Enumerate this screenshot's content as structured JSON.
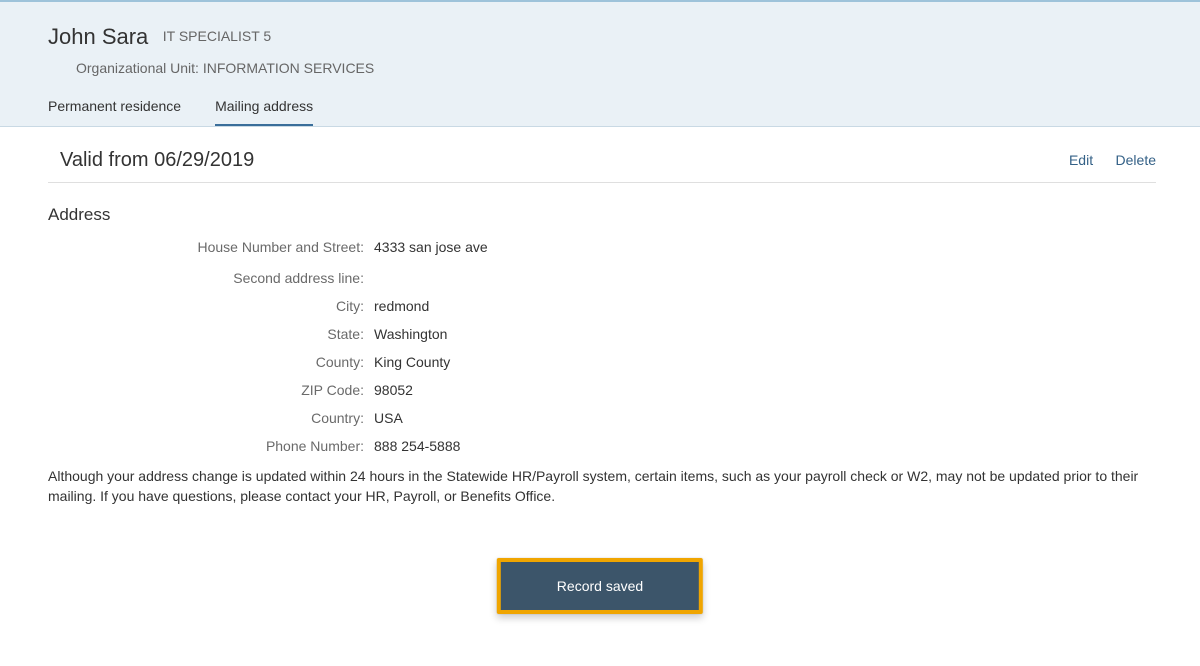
{
  "header": {
    "name": "John Sara",
    "job_title": "IT SPECIALIST 5",
    "org_unit": "Organizational Unit: INFORMATION SERVICES"
  },
  "tabs": [
    {
      "label": "Permanent residence",
      "active": false
    },
    {
      "label": "Mailing address",
      "active": true
    }
  ],
  "content": {
    "valid_from": "Valid from 06/29/2019",
    "edit_label": "Edit",
    "delete_label": "Delete",
    "section_title": "Address",
    "fields": {
      "house_label": "House Number and Street:",
      "house_value": "4333 san jose ave",
      "second_label": "Second address line:",
      "second_value": "",
      "city_label": "City:",
      "city_value": "redmond",
      "state_label": "State:",
      "state_value": "Washington",
      "county_label": "County:",
      "county_value": "King County",
      "zip_label": "ZIP Code:",
      "zip_value": "98052",
      "country_label": "Country:",
      "country_value": "USA",
      "phone_label": "Phone Number:",
      "phone_value": "888 254-5888"
    },
    "note": "Although your address change is updated within 24 hours in the Statewide HR/Payroll system, certain items, such as your payroll check or W2, may not be updated prior to their mailing. If you have questions, please contact your HR, Payroll, or Benefits Office."
  },
  "toast": {
    "message": "Record saved"
  }
}
